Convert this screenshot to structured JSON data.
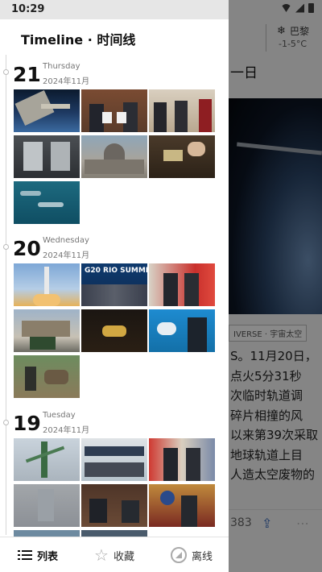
{
  "status_bar": {
    "time": "10:29"
  },
  "background_article": {
    "weather_city": "巴黎",
    "weather_temp": "-1-5°C",
    "title_fragment": "一日",
    "tag": "IVERSE · 宇宙太空",
    "text_lines": [
      "S。11月20日，",
      "点火5分31秒",
      "次临时轨道调",
      "碎片相撞的风",
      "以来第39次采取",
      "地球轨道上目",
      "人造太空废物的"
    ],
    "count": "383"
  },
  "drawer": {
    "title": "Timeline · 时间线",
    "days": [
      {
        "day": "21",
        "weekday": "Thursday",
        "month": "2024年11月"
      },
      {
        "day": "20",
        "weekday": "Wednesday",
        "month": "2024年11月"
      },
      {
        "day": "19",
        "weekday": "Tuesday",
        "month": "2024年11月"
      }
    ],
    "thumbs": {
      "g20_banner": "G20 RIO SUMMIT"
    }
  },
  "tabbar": {
    "list_label": "列表",
    "favorites_label": "收藏",
    "offline_label": "离线"
  },
  "colors": {
    "drawer_bg": "#ffffff",
    "scrim": "rgba(0,0,0,0.45)",
    "accent_blue": "#3a6ab8",
    "timeline_line": "#d6d6d6"
  }
}
